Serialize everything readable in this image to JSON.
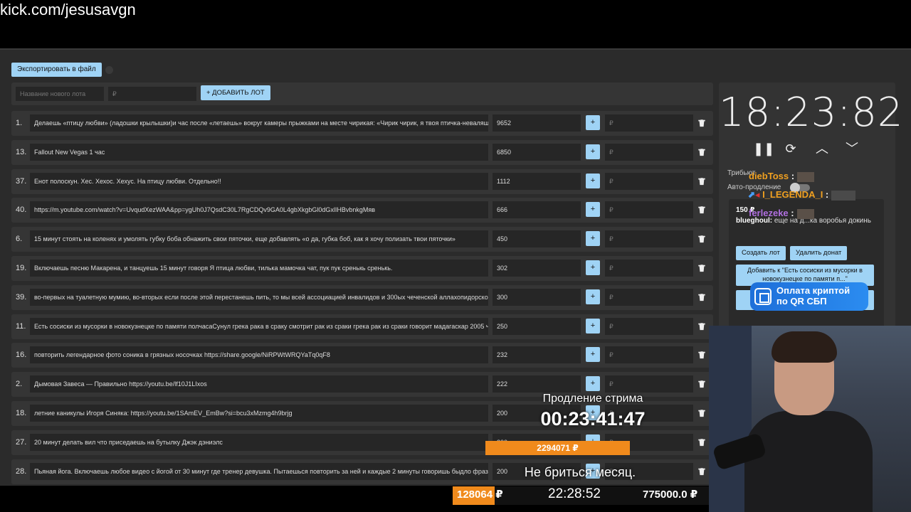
{
  "stream_url": "kick.com/jesusavgn",
  "toolbar": {
    "export_label": "Экспортировать в файл"
  },
  "new_lot": {
    "name_placeholder": "Название нового лота",
    "amount_placeholder": "₽",
    "add_label": "+ ДОБАВИТЬ ЛОТ"
  },
  "lots": [
    {
      "num": "1.",
      "name": "Делаешь «птицу любви» (ладошки крылышки)и час после «летаешь» вокруг камеры прыжками на месте чирикая: «Чирик чирик, я твоя птичка-неваляшка",
      "amount": "9652"
    },
    {
      "num": "13.",
      "name": "Fallout New Vegas 1 час",
      "amount": "6850"
    },
    {
      "num": "37.",
      "name": "Енот полоскун. Хес. Хехос. Хехус. На птицу любви. Отдельно!!",
      "amount": "1112"
    },
    {
      "num": "40.",
      "name": "https://m.youtube.com/watch?v=UvqudXezWAA&pp=ygUh0J7QsdC30L7RgCDQv9GA0L4gbXkgbGl0dGxlIHBvbnkgMяв",
      "amount": "666"
    },
    {
      "num": "6.",
      "name": "15 минут стоять на коленях и умолять губку боба обнажить свои пяточки, еще добавлять «о да, губка боб, как я хочу полизать твои пяточки»",
      "amount": "450"
    },
    {
      "num": "19.",
      "name": "Включаешь песню Макарена, и танцуешь 15 минут говоря Я птица любви, тилька мамочка чат, пук пук сренькь сренькь.",
      "amount": "302"
    },
    {
      "num": "39.",
      "name": "во-первых на туалетную мумию, во-вторых если после этой перестанешь пить, то мы всей ассоциацией инвалидов и 300ых чеченской аллахопидорской",
      "amount": "300"
    },
    {
      "num": "11.",
      "name": "Есть сосиски из мусорки в новокузнецке по памяти полчасаСунул грека рака в сраку смотрит рак из сраки грека рак из сраки говорит мадагаскар 2005 ч",
      "amount": "250"
    },
    {
      "num": "16.",
      "name": "повторить легендарное фото соника в грязных носочках https://share.google/NiRPWtWRQYaTq0qF8",
      "amount": "232"
    },
    {
      "num": "2.",
      "name": "Дымовая Завеса — Правильно https://youtu.be/lf10J1LIxos",
      "amount": "222"
    },
    {
      "num": "18.",
      "name": "летние каникулы Игоря Синяка: https://youtu.be/1SAmEV_EmBw?si=bcu3xMzmg4h9brjg",
      "amount": "200"
    },
    {
      "num": "27.",
      "name": "20 минут делать вил что приседаешь на бутылку Джэк дэниэлс",
      "amount": "200"
    },
    {
      "num": "28.",
      "name": "Пьяная йога. Включаешь любое видео с йогой от 30 минут где тренер девушка. Пытаешься повторить за ней и каждые 2 минуты говоришь быдло фраз",
      "amount": "200"
    }
  ],
  "lot_plus_label": "+",
  "lot_input_placeholder": "₽",
  "side": {
    "timer": "18:23:82",
    "tribute_label": "Трибьют",
    "auto_label": "Авто-продление",
    "donate_amount": "150 ₽",
    "donate_user": "blueghoul:",
    "donate_message": "еще на д...ка воробья докинь",
    "create_lot_label": "Создать лот",
    "delete_donate_label": "Удалить донат",
    "add_to_label": "Добавить к \"Есть сосиски из мусорки в новокузнецке по памяти п...\""
  },
  "chat": [
    {
      "user": "diebToss",
      "sep": " :",
      "color": "#f0a020"
    },
    {
      "user": "I_LEGENDA_I",
      "sep": " :",
      "color": "#f0a020"
    },
    {
      "user": "ferlezeke",
      "sep": " :",
      "color": "#b070e0"
    }
  ],
  "qr_badge": {
    "line1": "Оплата криптой",
    "line2": "по QR СБП"
  },
  "overlay": {
    "extension_label": "Продление стрима",
    "extension_timer": "00:23:41:47",
    "total": "2294071 ₽",
    "goal": "Не бриться месяц."
  },
  "bottom": {
    "left_amount": "128064 ₽",
    "clock": "22:28:52",
    "right_amount": "775000.0 ₽",
    "progress": 0.165
  }
}
